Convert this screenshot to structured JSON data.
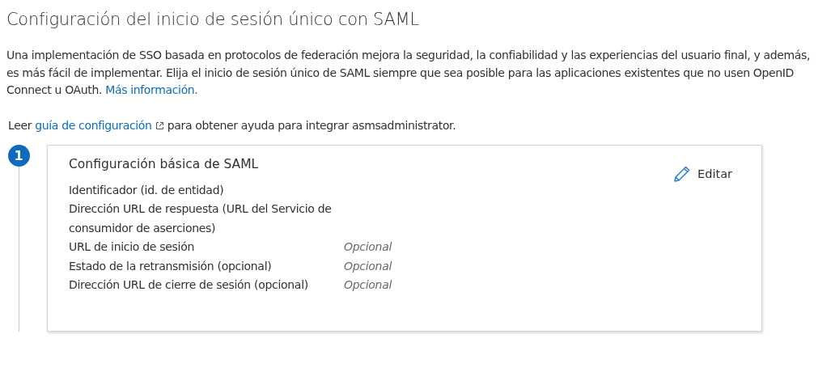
{
  "title": "Configuración del inicio de sesión único con SAML",
  "intro": {
    "text": "Una implementación de SSO basada en protocolos de federación mejora la seguridad, la confiabilidad y las experiencias del usuario final, y además, es más fácil de implementar. Elija el inicio de sesión único de SAML siempre que sea posible para las aplicaciones existentes que no usen OpenID Connect u OAuth.",
    "link": "Más información."
  },
  "guide": {
    "before": "Leer",
    "link": "guía de configuración",
    "after": "para obtener ayuda para integrar asmsadministrator."
  },
  "step": {
    "number": "1",
    "title": "Configuración básica de SAML",
    "edit_label": "Editar",
    "rows": [
      {
        "label": "Identificador (id. de entidad)"
      },
      {
        "label": "Dirección URL de respuesta (URL del Servicio de consumidor de aserciones)"
      },
      {
        "label": "URL de inicio de sesión",
        "value": "Opcional"
      },
      {
        "label": "Estado de la retransmisión (opcional)",
        "value": "Opcional"
      },
      {
        "label": "Dirección URL de cierre de sesión (opcional)",
        "value": "Opcional"
      }
    ]
  }
}
